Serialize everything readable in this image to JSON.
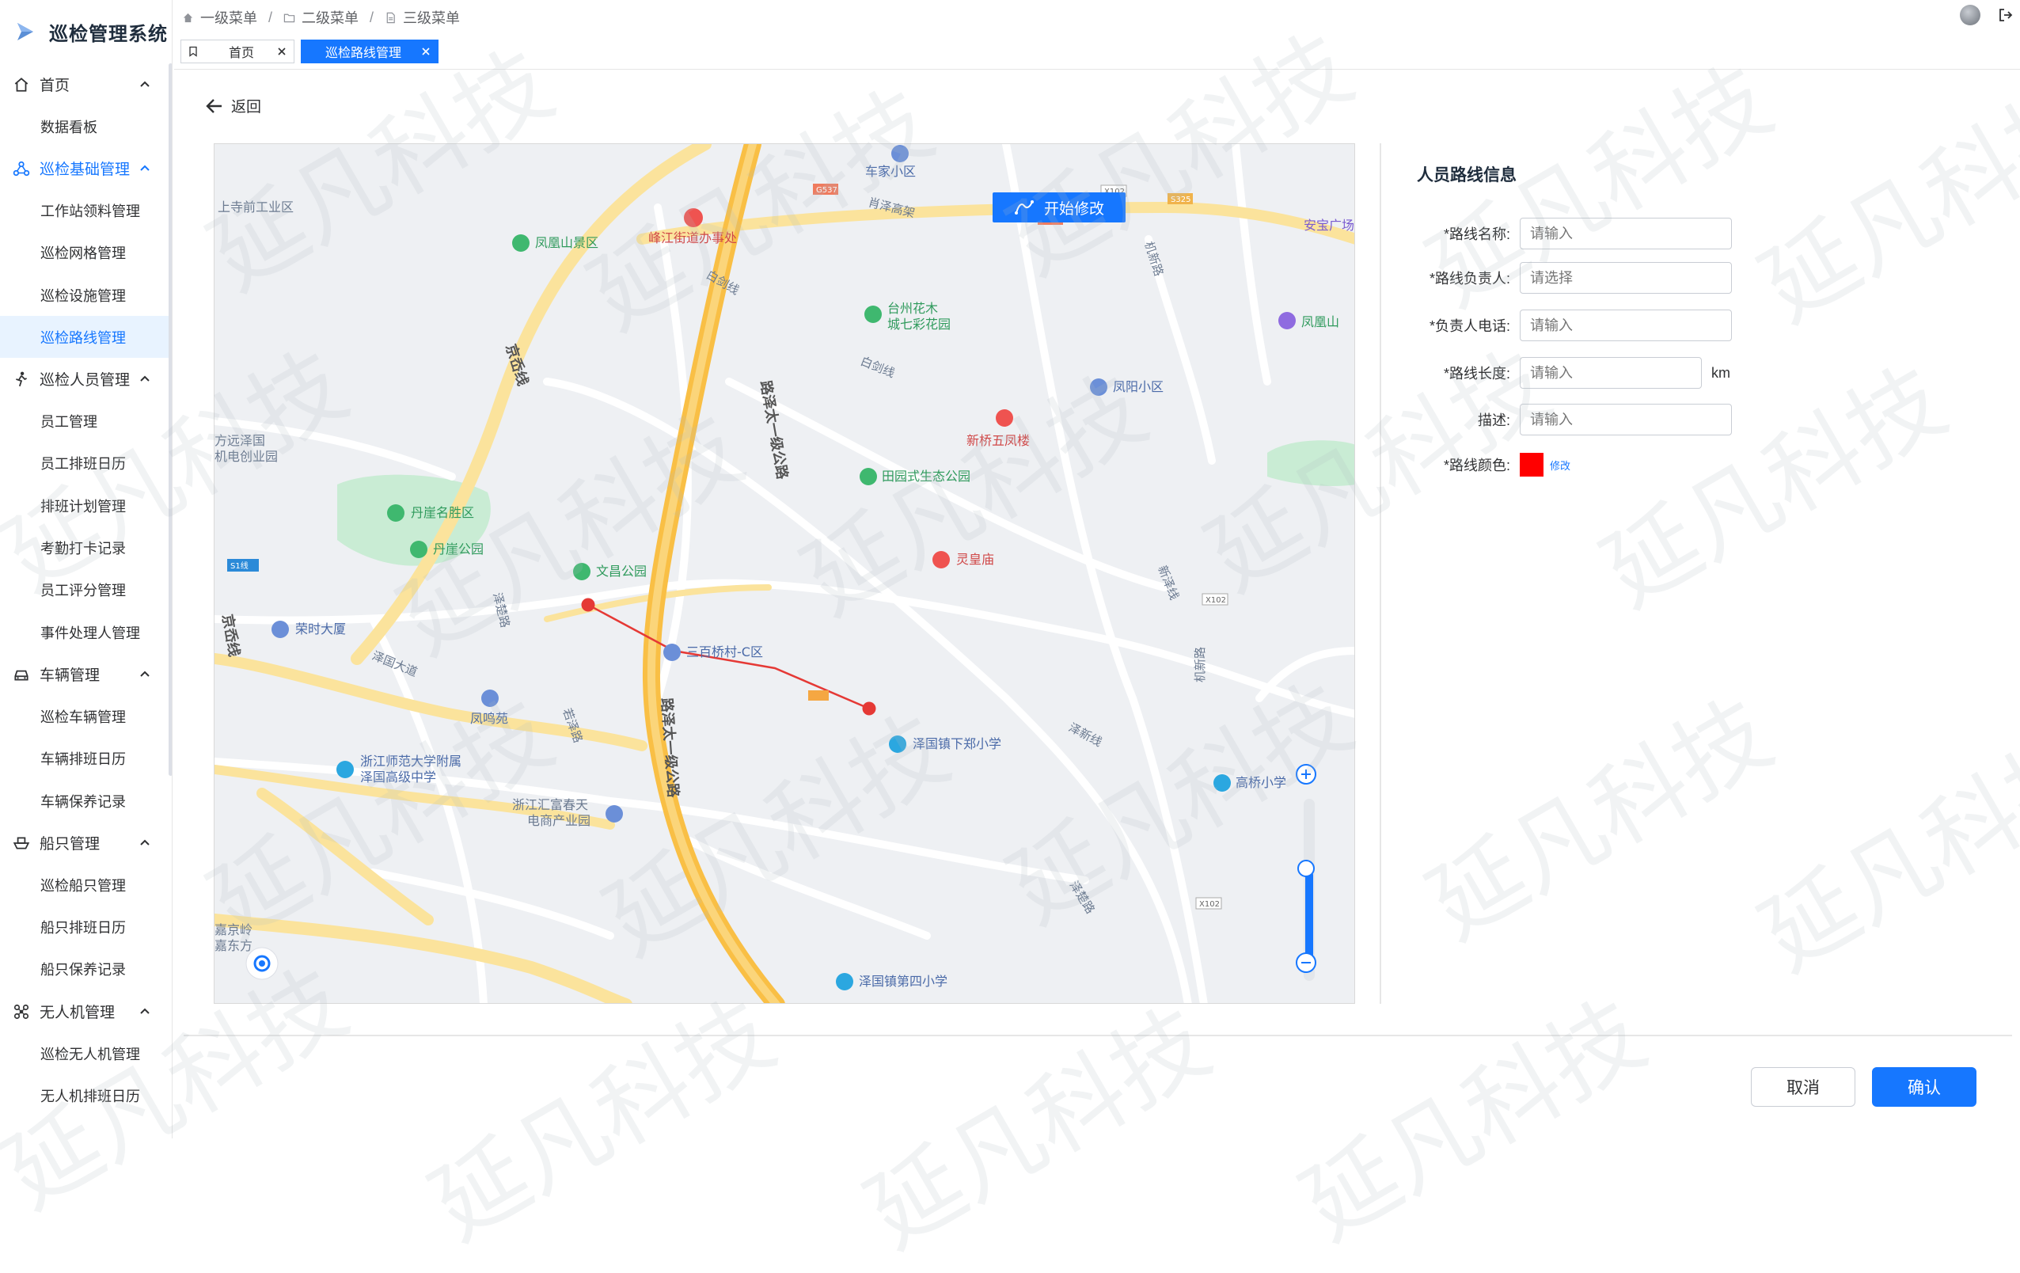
{
  "app": {
    "title": "巡检管理系统"
  },
  "breadcrumb": [
    "一级菜单",
    "二级菜单",
    "三级菜单"
  ],
  "tabs": [
    {
      "label": "首页",
      "active": false
    },
    {
      "label": "巡检路线管理",
      "active": true
    }
  ],
  "sidebar": {
    "groups": [
      {
        "label": "首页",
        "icon": "home-icon",
        "active": false,
        "items": [
          {
            "label": "数据看板",
            "active": false
          }
        ]
      },
      {
        "label": "巡检基础管理",
        "icon": "network-icon",
        "active": true,
        "items": [
          {
            "label": "工作站领料管理",
            "active": false
          },
          {
            "label": "巡检网格管理",
            "active": false
          },
          {
            "label": "巡检设施管理",
            "active": false
          },
          {
            "label": "巡检路线管理",
            "active": true
          }
        ]
      },
      {
        "label": "巡检人员管理",
        "icon": "person-icon",
        "active": false,
        "items": [
          {
            "label": "员工管理",
            "active": false
          },
          {
            "label": "员工排班日历",
            "active": false
          },
          {
            "label": "排班计划管理",
            "active": false
          },
          {
            "label": "考勤打卡记录",
            "active": false
          },
          {
            "label": "员工评分管理",
            "active": false
          },
          {
            "label": "事件处理人管理",
            "active": false
          }
        ]
      },
      {
        "label": "车辆管理",
        "icon": "car-icon",
        "active": false,
        "items": [
          {
            "label": "巡检车辆管理",
            "active": false
          },
          {
            "label": "车辆排班日历",
            "active": false
          },
          {
            "label": "车辆保养记录",
            "active": false
          }
        ]
      },
      {
        "label": "船只管理",
        "icon": "ship-icon",
        "active": false,
        "items": [
          {
            "label": "巡检船只管理",
            "active": false
          },
          {
            "label": "船只排班日历",
            "active": false
          },
          {
            "label": "船只保养记录",
            "active": false
          }
        ]
      },
      {
        "label": "无人机管理",
        "icon": "drone-icon",
        "active": false,
        "items": [
          {
            "label": "巡检无人机管理",
            "active": false
          },
          {
            "label": "无人机排班日历",
            "active": false
          }
        ]
      }
    ]
  },
  "content": {
    "back_label": "返回"
  },
  "map": {
    "edit_button": "开始修改",
    "route_color": "#ff0000",
    "labels": {
      "chejia": "车家小区",
      "sishangqian": "上寺前工业区",
      "fenghuangshan": "凤凰山景区",
      "jiedao": "峰江街道办事处",
      "anbao": "安宝广场",
      "fenghuangshan2": "凤凰山",
      "huamu1": "台州花木",
      "huamu2": "城七彩花园",
      "fengyang": "凤阳小区",
      "xinqiao": "新桥五凤楼",
      "tianyuan": "田园式生态公园",
      "danya": "丹崖名胜区",
      "danyapark": "丹崖公园",
      "wenchang": "文昌公园",
      "linghuang": "灵皇庙",
      "rongshi": "荣时大厦",
      "sanbaiqiao": "三百桥村-C区",
      "fengming": "凤鸣苑",
      "xiazheng": "泽国镇下郑小学",
      "gaoqiao": "高桥小学",
      "shida1": "浙江师范大学附属",
      "shida2": "泽国高级中学",
      "huifu1": "浙江汇富春天",
      "huifu2": "电商产业园",
      "disi": "泽国镇第四小学",
      "yuanze1": "方远泽国",
      "yuanze2": "机电创业园",
      "jingling1": "嘉京岭",
      "jingling2": "嘉东方",
      "road_zeguo": "路泽太一级公路",
      "road_jingyue": "京岙线",
      "road_zeguoda": "泽国大道",
      "road_baijian": "白剑线",
      "road_zexin": "泽新线",
      "road_jixin": "机新路",
      "road_zeguo2": "泽楚路",
      "road_xiaoshan": "肖泽高架",
      "road_ruo": "若泽路",
      "road_xinchen": "新泽线",
      "shield_g537": "G537",
      "shield_x102": "X102",
      "shield_s325": "S325",
      "shield_s1": "S1线"
    }
  },
  "form": {
    "title": "人员路线信息",
    "fields": [
      {
        "label": "*路线名称:",
        "placeholder": "请输入"
      },
      {
        "label": "*路线负责人:",
        "placeholder": "请选择"
      },
      {
        "label": "*负责人电话:",
        "placeholder": "请输入"
      },
      {
        "label": "*路线长度:",
        "placeholder": "请输入",
        "unit": "km"
      },
      {
        "label": "描述:",
        "placeholder": "请输入"
      }
    ],
    "color_label": "*路线颜色:",
    "color_value": "#ff0000",
    "color_modify": "修改"
  },
  "footer": {
    "cancel": "取消",
    "confirm": "确认"
  },
  "watermark": "延凡科技"
}
